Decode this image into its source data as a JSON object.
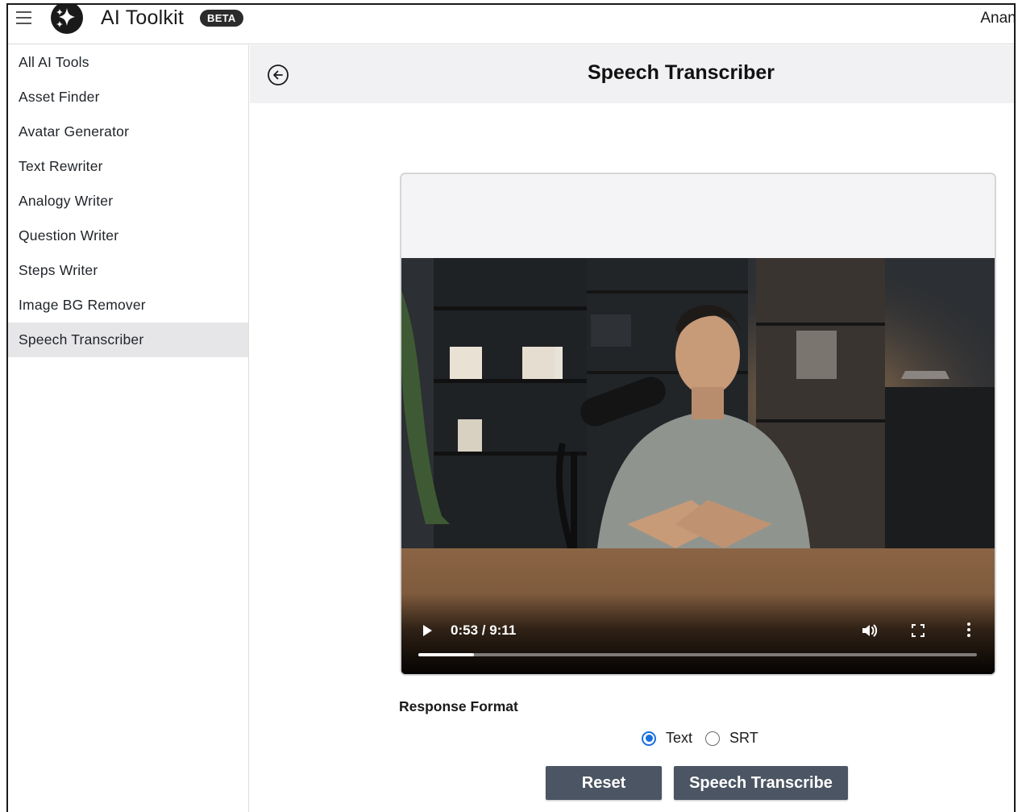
{
  "app": {
    "title": "AI Toolkit",
    "badge": "BETA",
    "user": "Anant"
  },
  "sidebar": {
    "items": [
      {
        "label": "All AI Tools"
      },
      {
        "label": "Asset Finder"
      },
      {
        "label": "Avatar Generator"
      },
      {
        "label": "Text Rewriter"
      },
      {
        "label": "Analogy Writer"
      },
      {
        "label": "Question Writer"
      },
      {
        "label": "Steps Writer"
      },
      {
        "label": "Image BG Remover"
      },
      {
        "label": "Speech Transcriber",
        "active": true
      }
    ]
  },
  "main": {
    "title": "Speech Transcriber",
    "video": {
      "time": "0:53 / 9:11",
      "progress_fraction": 0.1
    },
    "response_format": {
      "label": "Response Format",
      "options": [
        {
          "label": "Text",
          "checked": true
        },
        {
          "label": "SRT",
          "checked": false
        }
      ]
    },
    "buttons": {
      "reset": "Reset",
      "transcribe": "Speech Transcribe"
    }
  },
  "colors": {
    "accent": "#1a6fe0",
    "button": "#4b5563",
    "header_band": "#f1f1f3",
    "active_item": "#e6e6e9"
  },
  "icons": {
    "menu": "hamburger-icon",
    "logo": "sparkle-logo-icon",
    "back": "arrow-left-circle-icon",
    "play": "play-icon",
    "volume": "volume-icon",
    "fullscreen": "fullscreen-icon",
    "more": "more-vertical-icon"
  }
}
